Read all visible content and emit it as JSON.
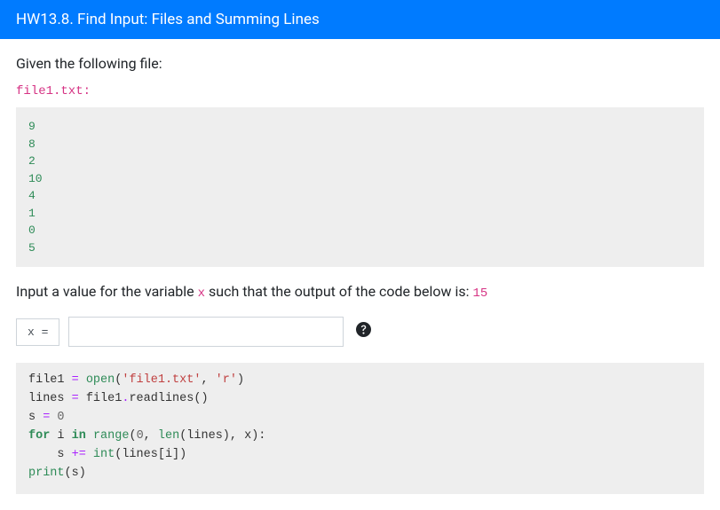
{
  "header": {
    "title": "HW13.8. Find Input: Files and Summing Lines"
  },
  "prompt": {
    "intro": "Given the following file:",
    "filename": "file1.txt",
    "file_lines": [
      "9",
      "8",
      "2",
      "10",
      "4",
      "1",
      "0",
      "5"
    ]
  },
  "instruction": {
    "prefix": "Input a value for the variable ",
    "var": "x",
    "middle": " such that the output of the code below is: ",
    "target": "15"
  },
  "input": {
    "label": "x =",
    "value": ""
  },
  "code": {
    "lines": [
      [
        {
          "t": "file1 ",
          "c": "c-default"
        },
        {
          "t": "=",
          "c": "c-op"
        },
        {
          "t": " ",
          "c": "c-default"
        },
        {
          "t": "open",
          "c": "c-builtin"
        },
        {
          "t": "(",
          "c": "c-default"
        },
        {
          "t": "'file1.txt'",
          "c": "c-str"
        },
        {
          "t": ", ",
          "c": "c-default"
        },
        {
          "t": "'r'",
          "c": "c-str"
        },
        {
          "t": ")",
          "c": "c-default"
        }
      ],
      [
        {
          "t": "lines ",
          "c": "c-default"
        },
        {
          "t": "=",
          "c": "c-op"
        },
        {
          "t": " file1",
          "c": "c-default"
        },
        {
          "t": ".",
          "c": "c-op"
        },
        {
          "t": "readlines()",
          "c": "c-default"
        }
      ],
      [
        {
          "t": "s ",
          "c": "c-default"
        },
        {
          "t": "=",
          "c": "c-op"
        },
        {
          "t": " ",
          "c": "c-default"
        },
        {
          "t": "0",
          "c": "c-num"
        }
      ],
      [
        {
          "t": "for",
          "c": "c-kw"
        },
        {
          "t": " i ",
          "c": "c-default"
        },
        {
          "t": "in",
          "c": "c-kw"
        },
        {
          "t": " ",
          "c": "c-default"
        },
        {
          "t": "range",
          "c": "c-builtin"
        },
        {
          "t": "(",
          "c": "c-default"
        },
        {
          "t": "0",
          "c": "c-num"
        },
        {
          "t": ", ",
          "c": "c-default"
        },
        {
          "t": "len",
          "c": "c-builtin"
        },
        {
          "t": "(lines), x):",
          "c": "c-default"
        }
      ],
      [
        {
          "t": "    s ",
          "c": "c-default"
        },
        {
          "t": "+=",
          "c": "c-op"
        },
        {
          "t": " ",
          "c": "c-default"
        },
        {
          "t": "int",
          "c": "c-builtin"
        },
        {
          "t": "(lines[i])",
          "c": "c-default"
        }
      ],
      [
        {
          "t": "print",
          "c": "c-builtin"
        },
        {
          "t": "(s)",
          "c": "c-default"
        }
      ]
    ]
  }
}
